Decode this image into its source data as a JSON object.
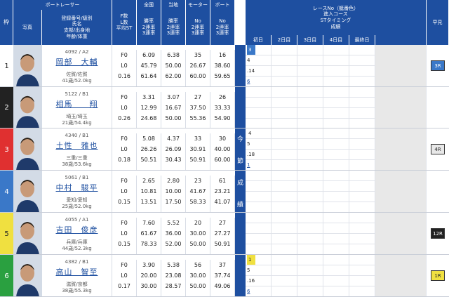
{
  "headers": {
    "waku": "枠",
    "photo": "写真",
    "boat_racer": "ボートレーサー",
    "racer_info": "登録番号/級別\n氏名\n支部/出身地\n年齢/体重",
    "flst": "F数\nL数\n平均ST",
    "national": "全国",
    "national_sub": "勝率\n2連率\n3連率",
    "local": "当地",
    "local_sub": "勝率\n2連率\n3連率",
    "motor": "モーター",
    "motor_sub": "No\n2連率\n3連率",
    "boat": "ボート",
    "boat_sub": "No\n2連率\n3連率",
    "race_title": "レースNo（艇番色）\n進入コース\nSTタイミング\n成績",
    "early": "早見",
    "days": [
      "初日",
      "2日目",
      "3日目",
      "4日目",
      "最終日"
    ],
    "konsetsu": [
      "今",
      "節",
      "成",
      "績"
    ]
  },
  "racers": [
    {
      "waku": "1",
      "color": "#ffffff",
      "reg": "4092 / A2",
      "name": "岡部　大輔",
      "branch": "佐賀/佐賀",
      "agew": "41歳/52.0kg",
      "f": "F0",
      "l": "L0",
      "st": "0.16",
      "n1": "6.09",
      "n2": "45.79",
      "n3": "61.64",
      "t1": "6.38",
      "t2": "50.00",
      "t3": "62.00",
      "m1": "35",
      "m2": "26.67",
      "m3": "60.00",
      "b1": "16",
      "b2": "38.60",
      "b3": "59.65",
      "race": [
        "3",
        "4",
        ".14",
        "6"
      ],
      "early": "3R",
      "early_color": "#3a78c8"
    },
    {
      "waku": "2",
      "color": "#222222",
      "reg": "5122 / B1",
      "name": "相馬　　翔",
      "branch": "埼玉/埼玉",
      "agew": "21歳/54.4kg",
      "f": "F0",
      "l": "L0",
      "st": "0.26",
      "n1": "3.31",
      "n2": "12.99",
      "n3": "24.68",
      "t1": "3.07",
      "t2": "16.67",
      "t3": "50.00",
      "m1": "27",
      "m2": "37.50",
      "m3": "55.36",
      "b1": "26",
      "b2": "33.33",
      "b3": "54.90",
      "race": [
        "",
        "",
        "",
        ""
      ],
      "early": "",
      "early_color": ""
    },
    {
      "waku": "3",
      "color": "#e03030",
      "reg": "4340 / B1",
      "name": "土性　雅也",
      "branch": "三重/三重",
      "agew": "38歳/53.6kg",
      "f": "F0",
      "l": "L0",
      "st": "0.18",
      "n1": "5.08",
      "n2": "26.26",
      "n3": "50.51",
      "t1": "4.37",
      "t2": "26.09",
      "t3": "30.43",
      "m1": "33",
      "m2": "30.91",
      "m3": "50.91",
      "b1": "30",
      "b2": "40.00",
      "b3": "60.00",
      "race": [
        "4",
        "5",
        ".18",
        "1"
      ],
      "early": "4R",
      "early_color": "#e8e8e8"
    },
    {
      "waku": "4",
      "color": "#3a78c8",
      "reg": "5061 / B1",
      "name": "中村　駿平",
      "branch": "愛知/愛知",
      "agew": "25歳/52.0kg",
      "f": "F0",
      "l": "L0",
      "st": "0.15",
      "n1": "2.65",
      "n2": "10.81",
      "n3": "13.51",
      "t1": "2.80",
      "t2": "10.00",
      "t3": "17.50",
      "m1": "23",
      "m2": "41.67",
      "m3": "58.33",
      "b1": "61",
      "b2": "23.21",
      "b3": "41.07",
      "race": [
        "",
        "",
        "",
        ""
      ],
      "early": "",
      "early_color": ""
    },
    {
      "waku": "5",
      "color": "#f0e040",
      "reg": "4055 / A1",
      "name": "吉田　俊彦",
      "branch": "兵庫/兵庫",
      "agew": "44歳/52.3kg",
      "f": "F0",
      "l": "L0",
      "st": "0.15",
      "n1": "7.60",
      "n2": "61.67",
      "n3": "78.33",
      "t1": "5.52",
      "t2": "36.00",
      "t3": "52.00",
      "m1": "20",
      "m2": "30.00",
      "m3": "50.00",
      "b1": "27",
      "b2": "27.27",
      "b3": "50.91",
      "race": [
        "",
        "",
        "",
        ""
      ],
      "early": "12R",
      "early_color": "#222222"
    },
    {
      "waku": "6",
      "color": "#2aa040",
      "reg": "4382 / B1",
      "name": "高山　智至",
      "branch": "滋賀/京都",
      "agew": "38歳/55.3kg",
      "f": "F0",
      "l": "L0",
      "st": "0.17",
      "n1": "3.90",
      "n2": "20.00",
      "n3": "30.00",
      "t1": "5.38",
      "t2": "23.08",
      "t3": "28.57",
      "m1": "56",
      "m2": "30.00",
      "m3": "50.00",
      "b1": "37",
      "b2": "37.74",
      "b3": "49.06",
      "race": [
        "1",
        "5",
        ".16",
        "6"
      ],
      "early": "1R",
      "early_color": "#f0e040"
    }
  ]
}
